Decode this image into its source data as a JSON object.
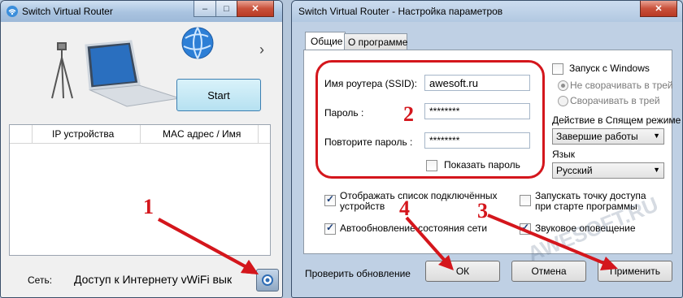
{
  "left_window": {
    "title": "Switch Virtual Router",
    "start_button": "Start",
    "chevron": "›",
    "table_columns": [
      "IP устройства",
      "MAC адрес / Имя"
    ],
    "status_label": "Сеть:",
    "status_text": "Доступ к Интернету  vWiFi вык"
  },
  "right_window": {
    "title": "Switch Virtual Router - Настройка параметров",
    "tabs": [
      "Общие",
      "О программе"
    ],
    "ssid_label": "Имя роутера (SSID):",
    "ssid_value": "awesoft.ru",
    "password_label": "Пароль :",
    "password_value": "********",
    "repeat_label": "Повторите пароль :",
    "repeat_value": "********",
    "show_password": "Показать пароль",
    "startup": "Запуск с Windows",
    "no_minimize": "Не сворачивать в трей",
    "minimize": "Сворачивать в трей",
    "sleep_label": "Действие в Спящем режиме",
    "sleep_value": "Завершие работы",
    "lang_label": "Язык",
    "lang_value": "Русский",
    "show_connected": "Отображать список подключённых устройств",
    "autostart_ap": "Запускать точку доступа при старте программы",
    "auto_update": "Автообновление состояния сети",
    "sound": "Звуковое оповещение",
    "check_update": "Проверить обновление",
    "ok": "ОК",
    "cancel": "Отмена",
    "apply": "Применить"
  },
  "annotations": [
    "1",
    "2",
    "3",
    "4"
  ],
  "watermark": "AWESOFT.RU",
  "colors": {
    "accent_red": "#d4161c",
    "start_button": "#bfe6f3"
  }
}
